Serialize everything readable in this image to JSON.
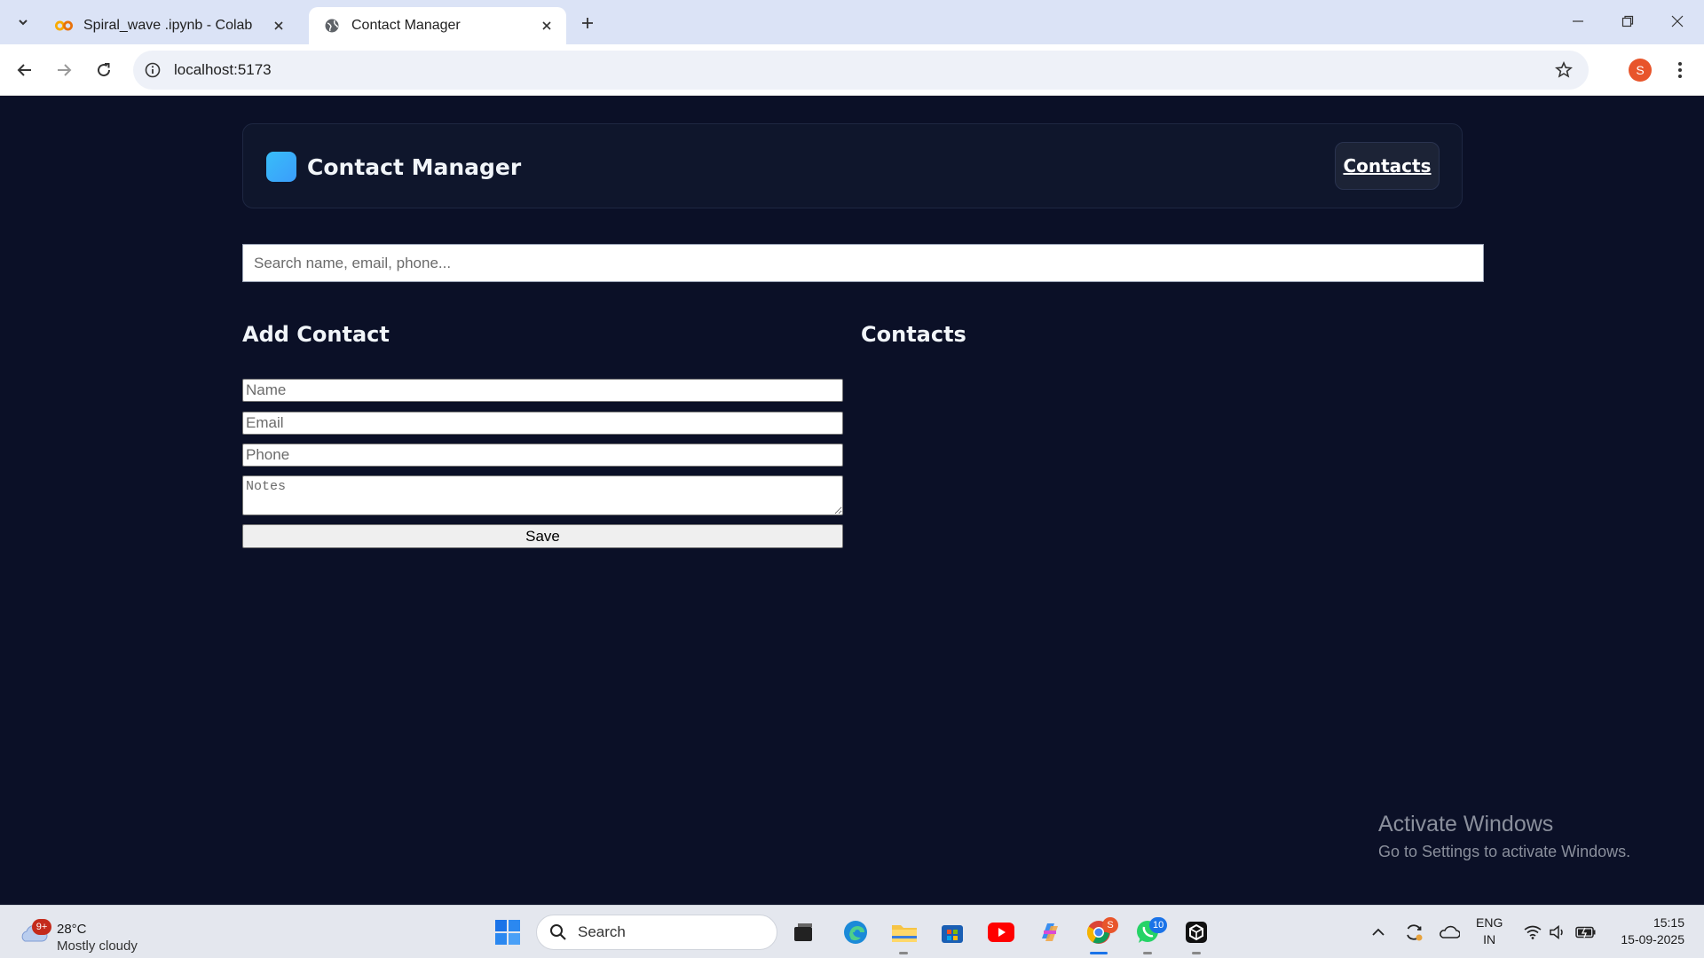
{
  "browser": {
    "tabs": [
      {
        "title": "Spiral_wave .ipynb - Colab",
        "icon": "colab-icon"
      },
      {
        "title": "Contact Manager",
        "icon": "globe-icon"
      }
    ],
    "url": "localhost:5173",
    "profile_initial": "S"
  },
  "app": {
    "brand": "Contact Manager",
    "nav_link": "Contacts",
    "search_placeholder": "Search name, email, phone...",
    "add_heading": "Add Contact",
    "list_heading": "Contacts",
    "form": {
      "name_placeholder": "Name",
      "email_placeholder": "Email",
      "phone_placeholder": "Phone",
      "notes_placeholder": "Notes",
      "save_label": "Save"
    },
    "colors": {
      "background": "#0b1027",
      "logo": "#38bdf8"
    }
  },
  "watermark": {
    "title": "Activate Windows",
    "subtitle": "Go to Settings to activate Windows."
  },
  "taskbar": {
    "weather_badge": "9+",
    "temperature": "28°C",
    "condition": "Mostly cloudy",
    "search_label": "Search",
    "chrome_badge": "S",
    "whatsapp_badge": "10",
    "lang_top": "ENG",
    "lang_bottom": "IN",
    "time": "15:15",
    "date": "15-09-2025"
  }
}
